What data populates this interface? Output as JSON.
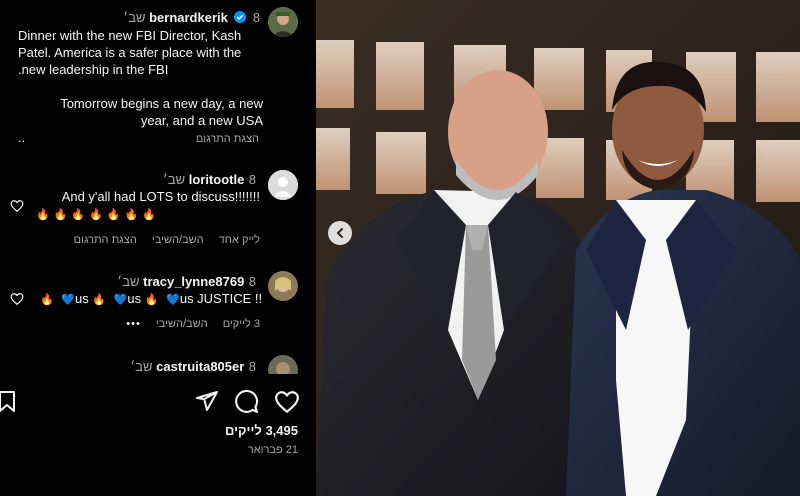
{
  "post": {
    "username": "bernardkerik",
    "time": "8 שב׳",
    "caption_lines": [
      "Dinner with the new FBI Director, Kash",
      "Patel. America is a safer place with the",
      ".new leadership in the FBI",
      "",
      "Tomorrow begins a new day, a new",
      "year, and a new USA",
      ".."
    ],
    "see_translation": "הצגת התרגום"
  },
  "comments": [
    {
      "username": "loritootle",
      "time": "8 שב׳",
      "text": "!!!!!!!And y'all had LOTS to discuss",
      "actions": {
        "like": "לייק אחד",
        "reply": "השב/השיבי",
        "translate": "הצגת התרגום"
      }
    },
    {
      "username": "tracy_lynne8769",
      "time": "8 שב׳",
      "text_us1": "us",
      "text_us2": "us",
      "text_us3": "us",
      "text_end": "us JUSTICE !!",
      "actions": {
        "likes": "3 לייקים",
        "reply": "השב/השיבי",
        "more": "•••"
      }
    },
    {
      "username": "castruita805er",
      "time": "8 שב׳"
    }
  ],
  "footer": {
    "likes": "3,495 לייקים",
    "date": "21 פברואר"
  },
  "icons": [
    "verified-badge-icon",
    "heart-icon",
    "comment-icon",
    "share-icon",
    "bookmark-icon",
    "chevron-left-icon",
    "fire-icon",
    "blue-heart-icon"
  ],
  "colors": {
    "verified": "#0095f6",
    "fire": "#ff7a1a",
    "blue_heart": "#3897f0"
  }
}
